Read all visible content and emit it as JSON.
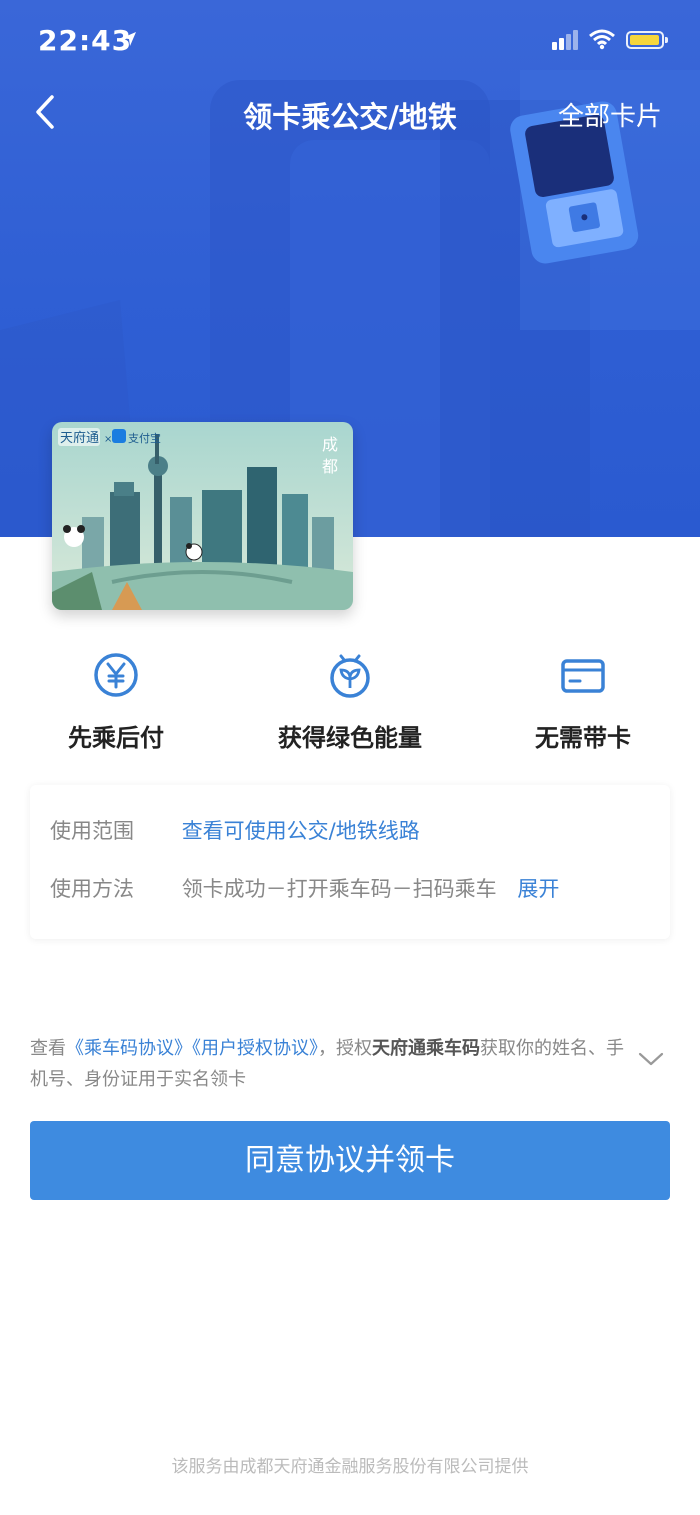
{
  "status_bar": {
    "time": "22:43"
  },
  "navbar": {
    "title": "领卡乘公交/地铁",
    "all_cards": "全部卡片"
  },
  "card": {
    "brand1": "天府通",
    "brand2": "支付宝",
    "city": "成都"
  },
  "features": [
    {
      "label": "先乘后付",
      "icon": "yen-icon"
    },
    {
      "label": "获得绿色能量",
      "icon": "sprout-icon"
    },
    {
      "label": "无需带卡",
      "icon": "card-icon"
    }
  ],
  "info": {
    "scope_label": "使用范围",
    "scope_link": "查看可使用公交/地铁线路",
    "method_label": "使用方法",
    "method_text": "领卡成功－打开乘车码－扫码乘车",
    "expand": "展开"
  },
  "agreement": {
    "prefix": "查看",
    "doc1": "《乘车码协议》",
    "doc2": "《用户授权协议》",
    "middle": "，授权",
    "bold": "天府通乘车码",
    "suffix": "获取你的姓名、手机号、身份证用于实名领卡"
  },
  "button": {
    "label": "同意协议并领卡"
  },
  "footer": {
    "text": "该服务由成都天府通金融服务股份有限公司提供"
  },
  "colors": {
    "hero": "#2f5fd4",
    "accent": "#3e8be0",
    "link": "#3a82d6"
  }
}
